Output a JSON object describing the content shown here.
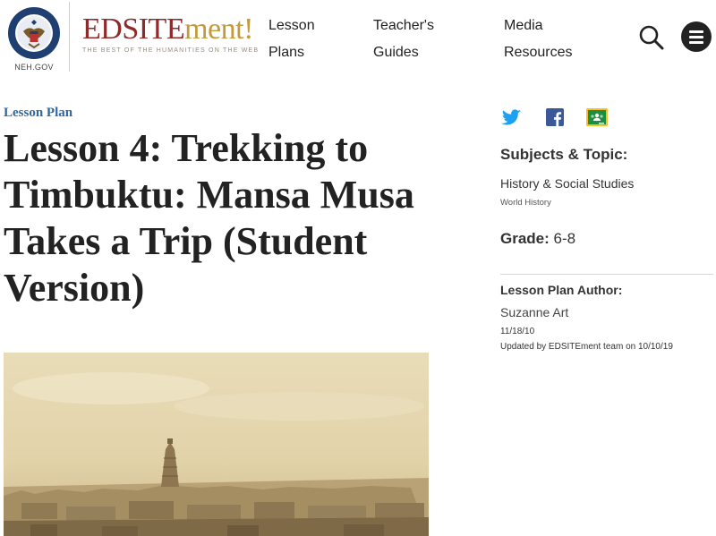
{
  "header": {
    "neh_label": "NEH.GOV",
    "brand": {
      "part1": "EDSITE",
      "part2": "ment!",
      "tagline": "THE BEST OF THE HUMANITIES ON THE WEB"
    },
    "nav": [
      {
        "line1": "Lesson",
        "line2": "Plans"
      },
      {
        "line1": "Teacher's",
        "line2": "Guides"
      },
      {
        "line1": "Media",
        "line2": "Resources"
      }
    ],
    "icons": {
      "search": "search-icon",
      "menu": "hamburger-menu-icon",
      "seal": "neh-seal-icon"
    }
  },
  "main": {
    "kicker": "Lesson Plan",
    "title": "Lesson 4: Trekking to Timbuktu: Mansa Musa Takes a Trip (Student Version)",
    "hero_image": "timbuktu-engraving"
  },
  "sidebar": {
    "share_icons": [
      "twitter-icon",
      "facebook-icon",
      "google-classroom-icon"
    ],
    "subjects_heading": "Subjects & Topic:",
    "subject": "History & Social Studies",
    "topic": "World History",
    "grade_label": "Grade:",
    "grade_value": "6-8",
    "author_heading": "Lesson Plan Author:",
    "author": "Suzanne Art",
    "date": "11/18/10",
    "updated": "Updated by EDSITEment team on 10/10/19"
  },
  "colors": {
    "brand_red": "#8e2a2a",
    "brand_gold": "#c49a3c",
    "kicker_blue": "#2d67a5",
    "twitter": "#1da1f2",
    "facebook": "#3b5998",
    "classroom_green": "#1e8e3e",
    "classroom_yellow": "#f6c026"
  }
}
